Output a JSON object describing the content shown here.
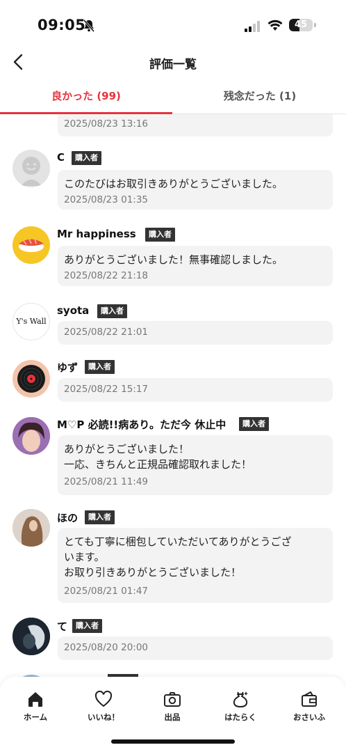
{
  "status_bar": {
    "time": "09:05",
    "battery_level": "45",
    "battery_fraction": 0.45
  },
  "header": {
    "title": "評価一覧"
  },
  "tabs": [
    {
      "label": "良かった (99)",
      "active": true
    },
    {
      "label": "残念だった (1)",
      "active": false
    }
  ],
  "reviews": [
    {
      "date": "2025/08/23 13:16"
    },
    {
      "name": "C",
      "badge": "購入者",
      "message": "このたびはお取引きありがとうございました。",
      "date": "2025/08/23 01:35"
    },
    {
      "name": "Mr happiness",
      "badge": "購入者",
      "message": "ありがとうございました！無事確認しました。",
      "date": "2025/08/22 21:18"
    },
    {
      "name": "syota",
      "badge": "購入者",
      "avatar_text": "Y's Wall",
      "date": "2025/08/22 21:01"
    },
    {
      "name": "ゆず",
      "badge": "購入者",
      "date": "2025/08/22 15:17"
    },
    {
      "name": "M♡P 必読!!病あり。ただ今 休止中",
      "badge": "購入者",
      "message_lines": [
        "ありがとうございました！",
        "一応、きちんと正規品確認取れました！"
      ],
      "date": "2025/08/21 11:49"
    },
    {
      "name": "ほの",
      "badge": "購入者",
      "message_lines": [
        "とても丁寧に梱包していただいてありがとうござ",
        "います。",
        "お取り引きありがとうございました！"
      ],
      "date": "2025/08/21 01:47"
    },
    {
      "name": "て",
      "badge": "購入者",
      "date": "2025/08/20 20:00"
    }
  ],
  "bottom_nav": [
    {
      "label": "ホーム",
      "icon": "home-icon"
    },
    {
      "label": "いいね！",
      "icon": "heart-icon"
    },
    {
      "label": "出品",
      "icon": "camera-icon"
    },
    {
      "label": "はたらく",
      "icon": "money-bag-icon"
    },
    {
      "label": "おさいふ",
      "icon": "wallet-icon"
    }
  ],
  "colors": {
    "accent": "#e5333c",
    "bubble_bg": "#f3f3f3",
    "badge_bg": "#333333"
  }
}
